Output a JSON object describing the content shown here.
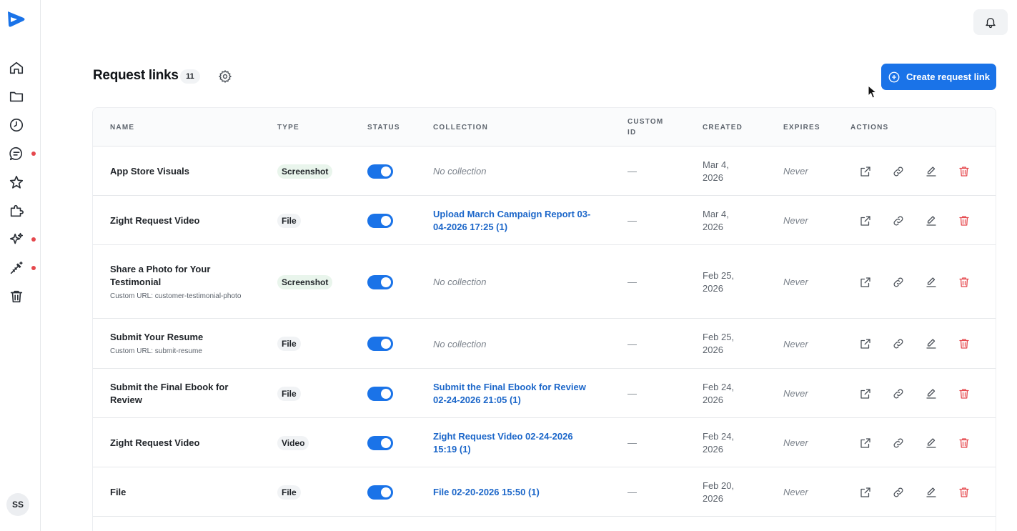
{
  "sidebar": {
    "nav": [
      {
        "icon": "home-icon"
      },
      {
        "icon": "folder-icon"
      },
      {
        "icon": "clock-icon"
      },
      {
        "icon": "chat-icon",
        "dot": true
      },
      {
        "icon": "star-icon"
      },
      {
        "icon": "puzzle-icon"
      },
      {
        "icon": "sparkles-icon",
        "dot": true
      },
      {
        "icon": "magic-wand-icon",
        "dot": true
      },
      {
        "icon": "trash-icon"
      }
    ],
    "avatar_initials": "SS"
  },
  "header": {
    "title": "Request links",
    "count": "11",
    "create_button": "Create request link"
  },
  "table": {
    "columns": {
      "name": "NAME",
      "type": "TYPE",
      "status": "STATUS",
      "collection": "COLLECTION",
      "custom_id_1": "CUSTOM",
      "custom_id_2": "ID",
      "created": "CREATED",
      "expires": "EXPIRES",
      "actions": "ACTIONS"
    },
    "rows": [
      {
        "name": "App Store Visuals",
        "sub": "",
        "type": "Screenshot",
        "status_on": true,
        "collection": "No collection",
        "collection_link": false,
        "custom_id": "—",
        "created_1": "Mar 4,",
        "created_2": "2026",
        "expires": "Never"
      },
      {
        "name": "Zight Request Video",
        "sub": "",
        "type": "File",
        "status_on": true,
        "collection": "Upload March Campaign Report 03-04-2026 17:25 (1)",
        "collection_link": true,
        "custom_id": "—",
        "created_1": "Mar 4,",
        "created_2": "2026",
        "expires": "Never"
      },
      {
        "name": "Share a Photo for Your Testimonial",
        "sub": "Custom URL: customer-testimonial-photo",
        "type": "Screenshot",
        "status_on": true,
        "collection": "No collection",
        "collection_link": false,
        "custom_id": "—",
        "created_1": "Feb 25,",
        "created_2": "2026",
        "expires": "Never"
      },
      {
        "name": "Submit Your Resume",
        "sub": "Custom URL: submit-resume",
        "type": "File",
        "status_on": true,
        "collection": "No collection",
        "collection_link": false,
        "custom_id": "—",
        "created_1": "Feb 25,",
        "created_2": "2026",
        "expires": "Never"
      },
      {
        "name": "Submit the Final Ebook for Review",
        "sub": "",
        "type": "File",
        "status_on": true,
        "collection": "Submit the Final Ebook for Review 02-24-2026 21:05 (1)",
        "collection_link": true,
        "custom_id": "—",
        "created_1": "Feb 24,",
        "created_2": "2026",
        "expires": "Never"
      },
      {
        "name": "Zight Request Video",
        "sub": "",
        "type": "Video",
        "status_on": true,
        "collection": "Zight Request Video 02-24-2026 15:19 (1)",
        "collection_link": true,
        "custom_id": "—",
        "created_1": "Feb 24,",
        "created_2": "2026",
        "expires": "Never"
      },
      {
        "name": "File",
        "sub": "",
        "type": "File",
        "status_on": true,
        "collection": "File 02-20-2026 15:50 (1)",
        "collection_link": true,
        "custom_id": "—",
        "created_1": "Feb 20,",
        "created_2": "2026",
        "expires": "Never"
      }
    ]
  },
  "colors": {
    "accent": "#1a73e8",
    "link": "#1b66c9",
    "danger": "#e5484d",
    "screenshot_badge": "#e9f5ec"
  }
}
